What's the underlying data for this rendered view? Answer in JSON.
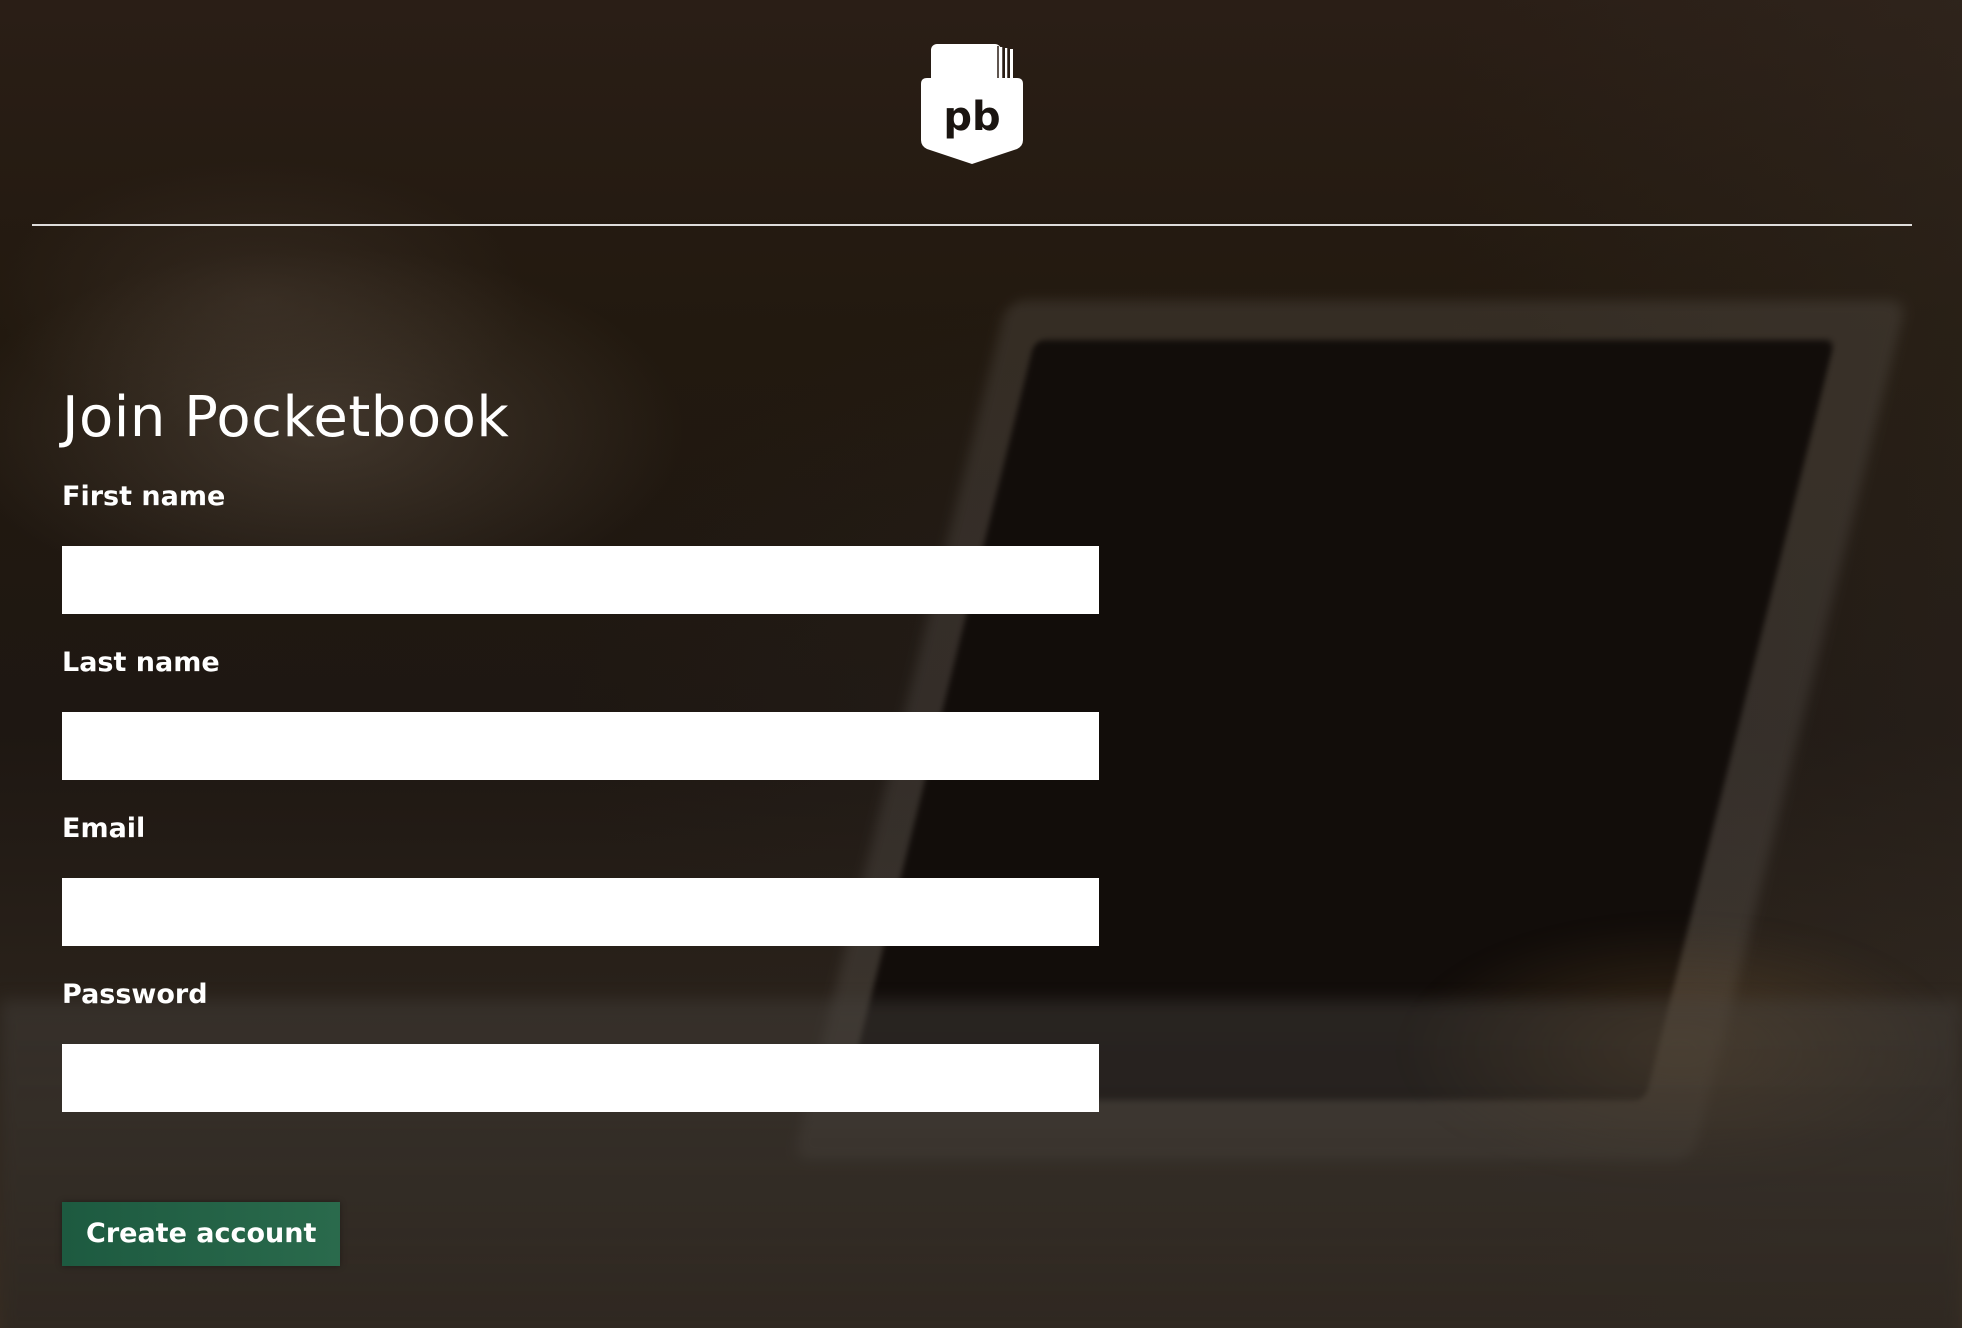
{
  "header": {
    "logo_text": "pb"
  },
  "form": {
    "title": "Join Pocketbook",
    "fields": [
      {
        "label": "First name",
        "value": "",
        "placeholder": "",
        "type": "text"
      },
      {
        "label": "Last name",
        "value": "",
        "placeholder": "",
        "type": "text"
      },
      {
        "label": "Email",
        "value": "",
        "placeholder": "",
        "type": "email"
      },
      {
        "label": "Password",
        "value": "",
        "placeholder": "",
        "type": "password"
      }
    ],
    "submit_label": "Create account"
  },
  "colors": {
    "button": "#1f5c42",
    "background": "#1e1712",
    "text": "#ffffff",
    "input": "#ffffff"
  },
  "icons": {
    "logo": "pocketbook-logo-icon"
  }
}
